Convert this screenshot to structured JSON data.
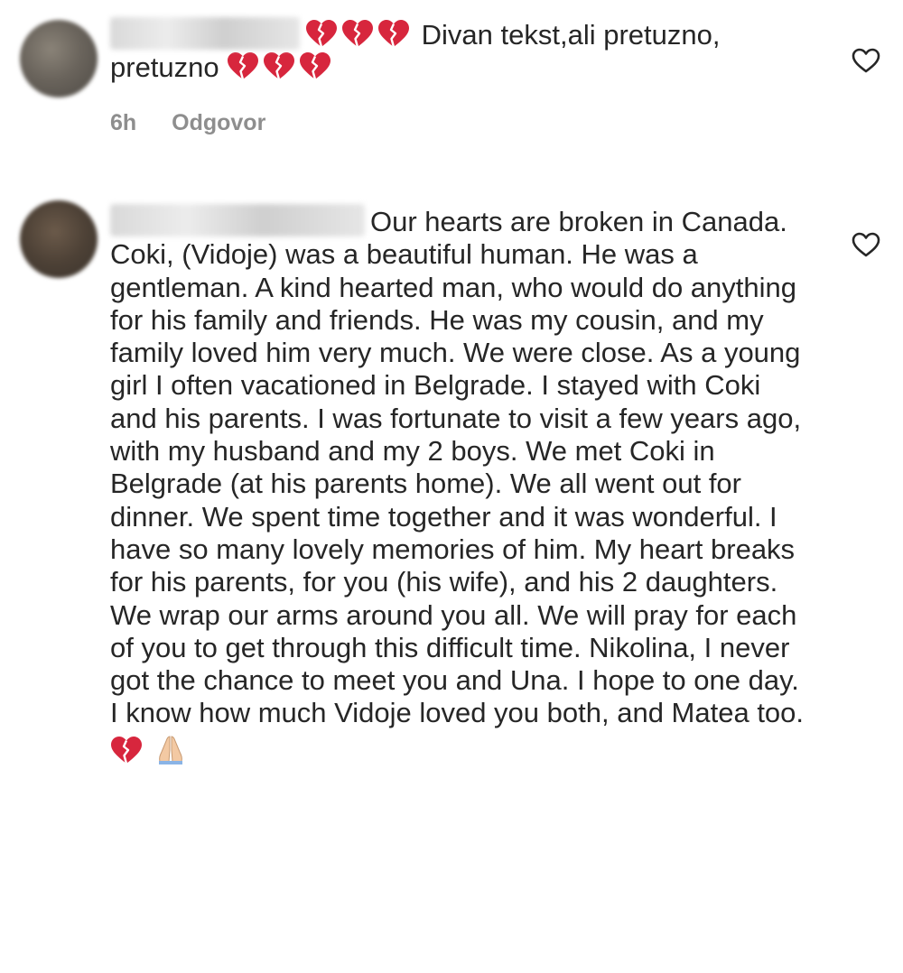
{
  "comments": [
    {
      "text_after_username": "Divan tekst,ali pretuzno,",
      "text_line2": "pretuzno",
      "leading_emojis": [
        "broken-heart",
        "broken-heart",
        "broken-heart"
      ],
      "trailing_emojis": [
        "broken-heart",
        "broken-heart",
        "broken-heart"
      ],
      "time": "6h",
      "reply_label": "Odgovor"
    },
    {
      "paragraph1": "Our hearts are broken in Canada. Coki, (Vidoje) was a beautiful human. He was a gentleman. A kind hearted man, who would do anything for his family and friends. He was my cousin, and my family loved him very much. We were close.  As a young girl I often vacationed in Belgrade. I stayed with Coki and his parents. I was fortunate to visit a few years ago, with my husband and my 2 boys. We met Coki in Belgrade (at his parents home). We all went out for dinner. We spent time together and it was wonderful. I have so many lovely memories of him. My heart breaks for his parents, for you (his wife), and his 2 daughters.",
      "paragraph2": "We wrap our arms around you all. We will pray for each of you to get through this difficult time.  Nikolina, I never got the chance to meet you and Una. I hope to one day. I know how much Vidoje loved you both, and Matea too.",
      "trailing_emojis": [
        "broken-heart",
        "folded-hands"
      ]
    }
  ],
  "colors": {
    "heart_red": "#d7263d",
    "meta_gray": "#8e8e8e",
    "text": "#262626"
  }
}
